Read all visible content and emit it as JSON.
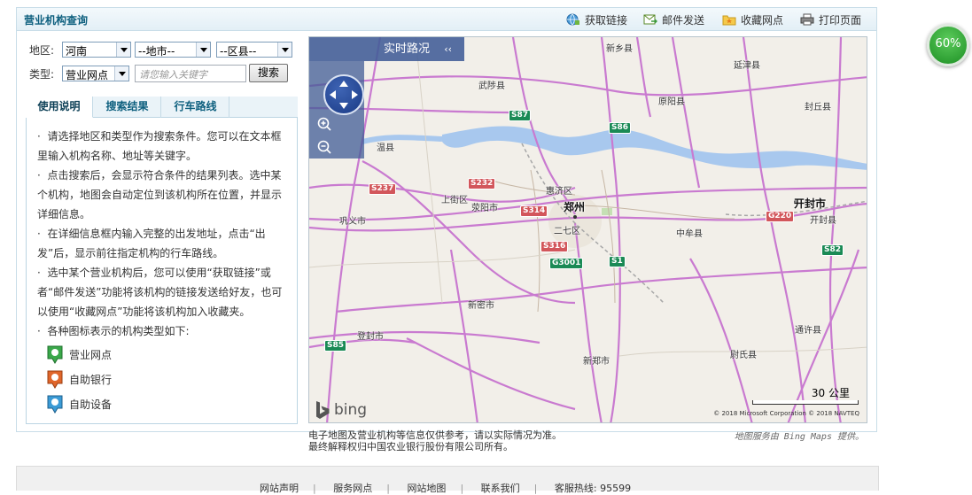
{
  "panel": {
    "title": "营业机构查询",
    "tools": [
      {
        "label": "获取链接",
        "icon": "globe-link-icon"
      },
      {
        "label": "邮件发送",
        "icon": "mail-send-icon"
      },
      {
        "label": "收藏网点",
        "icon": "folder-favorite-icon"
      },
      {
        "label": "打印页面",
        "icon": "printer-icon"
      }
    ]
  },
  "search": {
    "region_label": "地区:",
    "province": "河南",
    "city": "--地市--",
    "county": "--区县--",
    "type_label": "类型:",
    "type_value": "营业网点",
    "keyword_placeholder": "请您输入关键字",
    "button": "搜索"
  },
  "tabs": [
    "使用说明",
    "搜索结果",
    "行车路线"
  ],
  "help": {
    "paragraphs": [
      "请选择地区和类型作为搜索条件。您可以在文本框里输入机构名称、地址等关键字。",
      "点击搜索后，会显示符合条件的结果列表。选中某个机构，地图会自动定位到该机构所在位置，并显示详细信息。",
      "在详细信息框内输入完整的出发地址，点击“出发”后，显示前往指定机构的行车路线。",
      "选中某个营业机构后，您可以使用“获取链接”或者“邮件发送”功能将该机构的链接发送给好友，也可以使用“收藏网点”功能将该机构加入收藏夹。",
      "各种图标表示的机构类型如下:"
    ],
    "legend": [
      {
        "label": "营业网点",
        "color": "#3aa84a",
        "icon": "branch-pin-icon"
      },
      {
        "label": "自助银行",
        "color": "#e0662b",
        "icon": "self-service-bank-pin-icon"
      },
      {
        "label": "自助设备",
        "color": "#3b9bd6",
        "icon": "atm-device-pin-icon"
      }
    ]
  },
  "map": {
    "traffic_label": "实时路况",
    "traffic_chevron": "‹‹",
    "scale_label": "30 公里",
    "copyright": "© 2018 Microsoft Corporation  © 2018 NAVTEQ",
    "bing_label": "bing",
    "places": [
      {
        "name": "新乡县"
      },
      {
        "name": "延津县"
      },
      {
        "name": "武陟县"
      },
      {
        "name": "原阳县"
      },
      {
        "name": "封丘县"
      },
      {
        "name": "温县"
      },
      {
        "name": "惠济区"
      },
      {
        "name": "上街区"
      },
      {
        "name": "荥阳市"
      },
      {
        "name": "郑州"
      },
      {
        "name": "开封市"
      },
      {
        "name": "开封县"
      },
      {
        "name": "巩义市"
      },
      {
        "name": "二七区"
      },
      {
        "name": "中牟县"
      },
      {
        "name": "新密市"
      },
      {
        "name": "登封市"
      },
      {
        "name": "通许县"
      },
      {
        "name": "新郑市"
      },
      {
        "name": "尉氏县"
      }
    ],
    "shields": [
      {
        "code": "S87",
        "kind": "g"
      },
      {
        "code": "S86",
        "kind": "g"
      },
      {
        "code": "S237",
        "kind": "r"
      },
      {
        "code": "S232",
        "kind": "r"
      },
      {
        "code": "S314",
        "kind": "r"
      },
      {
        "code": "S316",
        "kind": "r"
      },
      {
        "code": "G3001",
        "kind": "g"
      },
      {
        "code": "S1",
        "kind": "g"
      },
      {
        "code": "G220",
        "kind": "r"
      },
      {
        "code": "S82",
        "kind": "g"
      },
      {
        "code": "S85",
        "kind": "g"
      }
    ]
  },
  "disclaimer": {
    "line1": "电子地图及营业机构等信息仅供参考，请以实际情况为准。",
    "line2": "最终解释权归中国农业银行股份有限公司所有。"
  },
  "map_credit": "地图服务由 Bing Maps 提供。",
  "footer": {
    "links": [
      "网站声明",
      "服务网点",
      "网站地图",
      "联系我们"
    ],
    "hotline": "客服热线: 95599"
  },
  "badge": "60%"
}
